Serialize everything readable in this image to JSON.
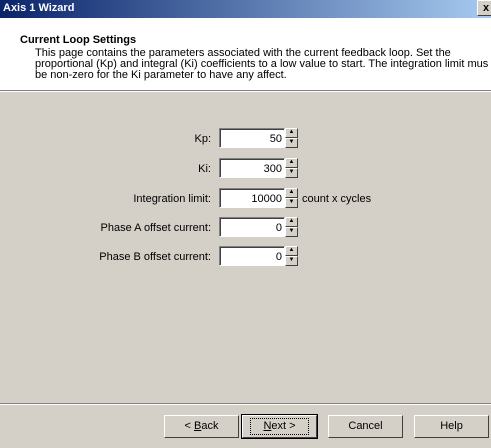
{
  "window": {
    "title": "Axis 1 Wizard",
    "close_glyph": "x"
  },
  "header": {
    "title": "Current Loop Settings",
    "description": "This page contains the parameters associated with the current feedback loop. Set the proportional (Kp) and integral (Ki) coefficients to a low value to start. The integration limit mus be non-zero for the Ki parameter to have any affect."
  },
  "fields": {
    "kp": {
      "label": "Kp:",
      "value": "50"
    },
    "ki": {
      "label": "Ki:",
      "value": "300"
    },
    "integration_limit": {
      "label": "Integration limit:",
      "value": "10000",
      "unit": "count x cycles"
    },
    "phase_a": {
      "label": "Phase A offset current:",
      "value": "0"
    },
    "phase_b": {
      "label": "Phase B offset current:",
      "value": "0"
    }
  },
  "buttons": {
    "back_prefix": "< ",
    "back_hotkey": "B",
    "back_rest": "ack",
    "next_hotkey": "N",
    "next_rest": "ext >",
    "cancel": "Cancel",
    "help": "Help"
  },
  "icons": {
    "spin_up": "up-arrow-icon",
    "spin_down": "down-arrow-icon"
  }
}
